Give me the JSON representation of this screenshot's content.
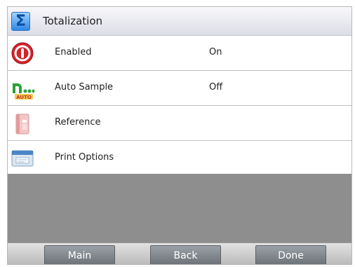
{
  "header": {
    "title": "Totalization",
    "icon": "sigma-icon"
  },
  "rows": [
    {
      "label": "Enabled",
      "value": "On",
      "icon": "power-icon"
    },
    {
      "label": "Auto Sample",
      "value": "Off",
      "icon": "auto-sample-icon",
      "icon_text": "AUTO"
    },
    {
      "label": "Reference",
      "value": "",
      "icon": "reference-book-icon"
    },
    {
      "label": "Print Options",
      "value": "",
      "icon": "printer-icon"
    }
  ],
  "footer": {
    "main_label": "Main",
    "back_label": "Back",
    "done_label": "Done"
  },
  "colors": {
    "accent_blue": "#2f86e6",
    "power_red": "#d3232a",
    "auto_green": "#2aa336",
    "button_gray": "#7f858b",
    "content_gray": "#8e8e8e"
  }
}
